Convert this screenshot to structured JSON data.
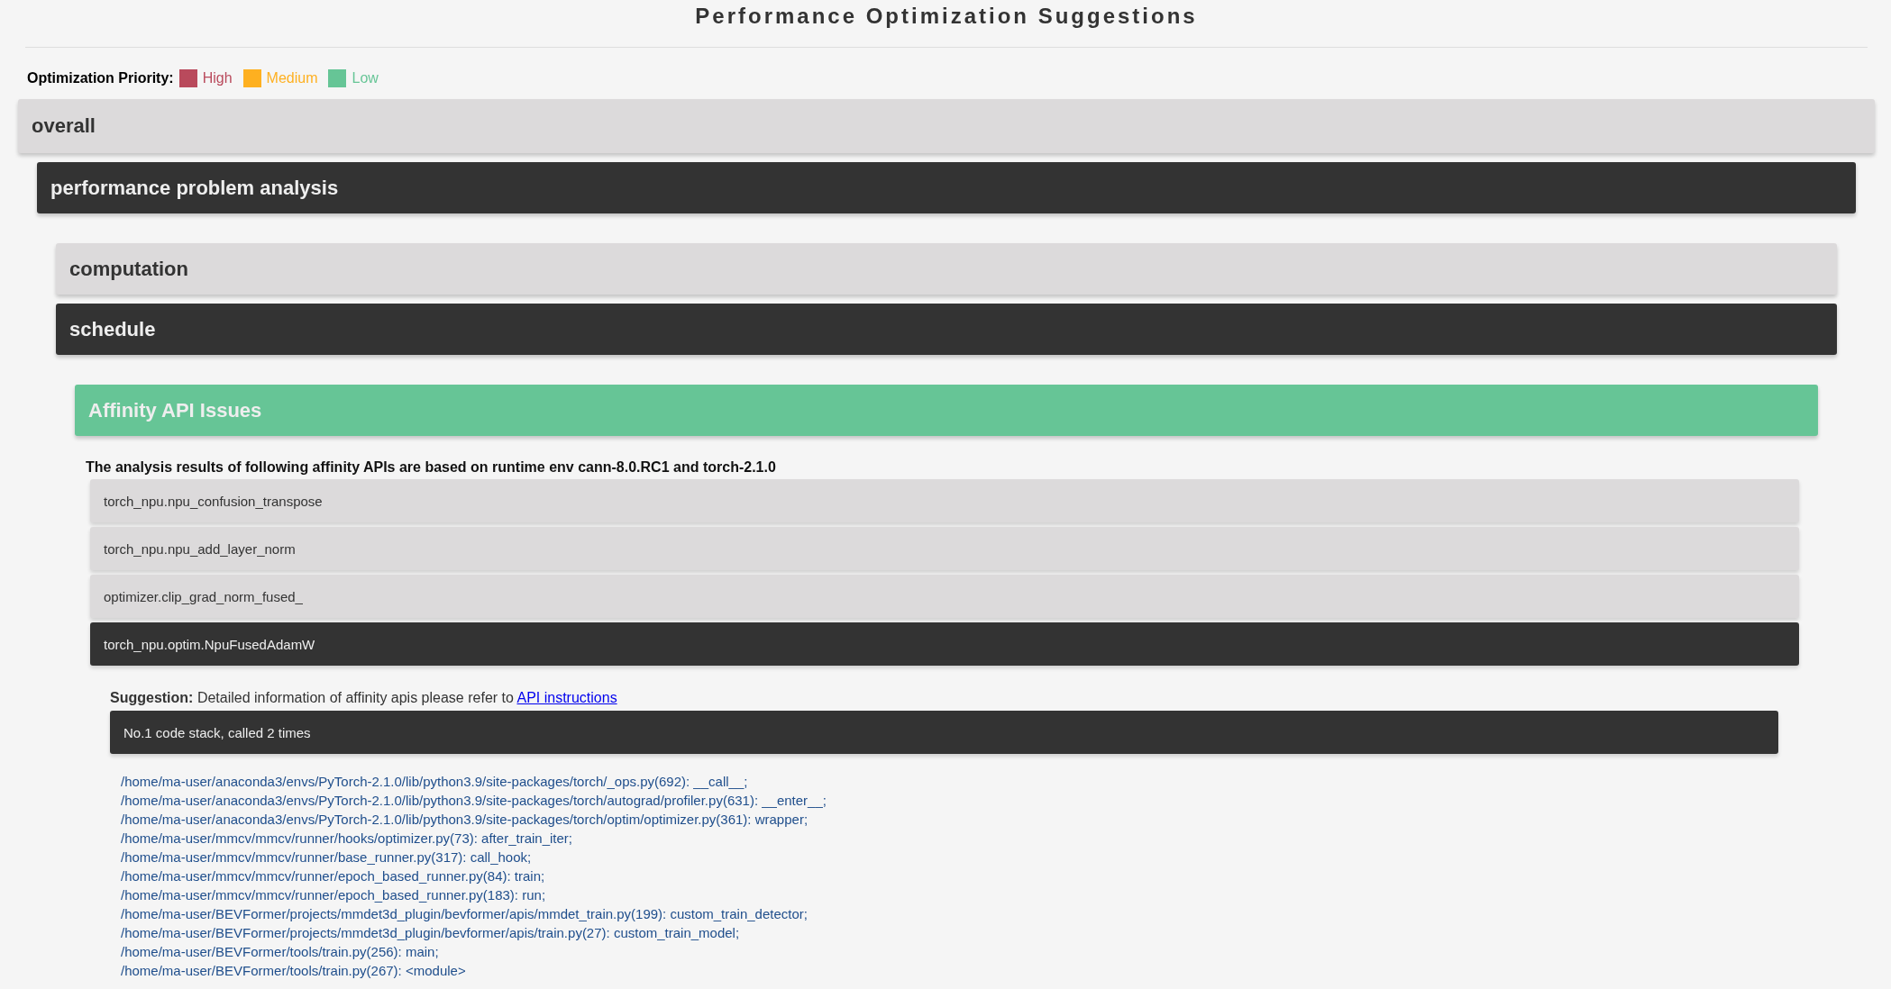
{
  "title": "Performance Optimization Suggestions",
  "legend": {
    "label": "Optimization Priority:",
    "items": [
      {
        "label": "High",
        "color": "#b94a5c"
      },
      {
        "label": "Medium",
        "color": "#feb020"
      },
      {
        "label": "Low",
        "color": "#66c596"
      }
    ]
  },
  "sections": [
    {
      "title": "overall",
      "active": false,
      "children": [
        {
          "title": "performance problem analysis",
          "active": true,
          "children": [
            {
              "title": "computation",
              "active": false
            },
            {
              "title": "schedule",
              "active": true,
              "children": [
                {
                  "title": "Affinity API Issues",
                  "kind": "issue",
                  "color": "#66c596",
                  "note": "The analysis results of following affinity APIs are based on runtime env cann-8.0.RC1 and torch-2.1.0",
                  "apis": [
                    {
                      "name": "torch_npu.npu_confusion_transpose",
                      "active": false
                    },
                    {
                      "name": "torch_npu.npu_add_layer_norm",
                      "active": false
                    },
                    {
                      "name": "optimizer.clip_grad_norm_fused_",
                      "active": false
                    },
                    {
                      "name": "torch_npu.optim.NpuFusedAdamW",
                      "active": true,
                      "suggestion": {
                        "label": "Suggestion:",
                        "text": "Detailed information of affinity apis please refer to",
                        "link": "API instructions"
                      },
                      "stacks": [
                        {
                          "title": "No.1 code stack, called 2 times",
                          "active": true,
                          "lines": [
                            "/home/ma-user/anaconda3/envs/PyTorch-2.1.0/lib/python3.9/site-packages/torch/_ops.py(692): __call__;",
                            "/home/ma-user/anaconda3/envs/PyTorch-2.1.0/lib/python3.9/site-packages/torch/autograd/profiler.py(631): __enter__;",
                            "/home/ma-user/anaconda3/envs/PyTorch-2.1.0/lib/python3.9/site-packages/torch/optim/optimizer.py(361): wrapper;",
                            "/home/ma-user/mmcv/mmcv/runner/hooks/optimizer.py(73): after_train_iter;",
                            "/home/ma-user/mmcv/mmcv/runner/base_runner.py(317): call_hook;",
                            "/home/ma-user/mmcv/mmcv/runner/epoch_based_runner.py(84): train;",
                            "/home/ma-user/mmcv/mmcv/runner/epoch_based_runner.py(183): run;",
                            "/home/ma-user/BEVFormer/projects/mmdet3d_plugin/bevformer/apis/mmdet_train.py(199): custom_train_detector;",
                            "/home/ma-user/BEVFormer/projects/mmdet3d_plugin/bevformer/apis/train.py(27): custom_train_model;",
                            "/home/ma-user/BEVFormer/tools/train.py(256): main;",
                            "/home/ma-user/BEVFormer/tools/train.py(267): <module>"
                          ]
                        }
                      ]
                    }
                  ]
                }
              ]
            }
          ]
        }
      ]
    }
  ]
}
